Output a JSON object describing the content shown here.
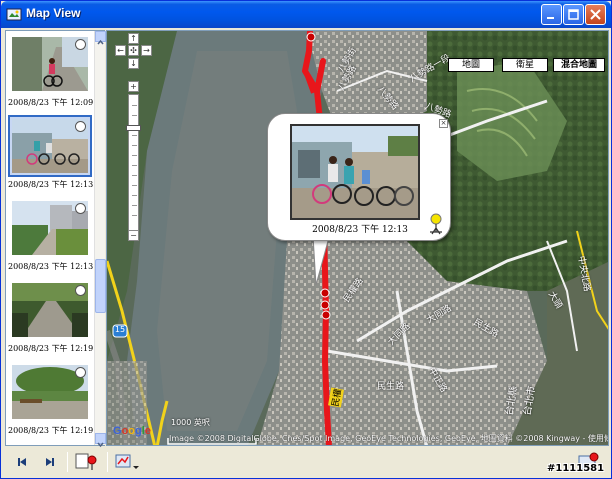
{
  "window": {
    "title": "Map View"
  },
  "thumbnails": [
    {
      "caption": "2008/8/23 下午 12:09",
      "selected": false
    },
    {
      "caption": "2008/8/23 下午 12:13",
      "selected": true
    },
    {
      "caption": "2008/8/23 下午 12:13",
      "selected": false
    },
    {
      "caption": "2008/8/23 下午 12:19",
      "selected": false
    },
    {
      "caption": "2008/8/23 下午 12:19",
      "selected": false
    }
  ],
  "map": {
    "map_types": [
      "地圖",
      "衛星",
      "混合地圖"
    ],
    "active_map_type": "混合地圖",
    "popup": {
      "caption": "2008/8/23 下午 12:13"
    },
    "scale_label": "1000 英呎",
    "copyright": "Image ©2008 DigitalGlobe, Cnes/Spot Image, GeoEye Technologies, GeoEye, 地圖資料 ©2008 Kingway - 使用條款",
    "street_labels": [
      {
        "text": "八勢街"
      },
      {
        "text": "八勢路"
      },
      {
        "text": "八勢路"
      },
      {
        "text": "八勢路一段"
      },
      {
        "text": "八勢路"
      },
      {
        "text": "民權路"
      },
      {
        "text": "大同路"
      },
      {
        "text": "大同路"
      },
      {
        "text": "民生路"
      },
      {
        "text": "民生路"
      },
      {
        "text": "中正路"
      },
      {
        "text": "台北縣"
      },
      {
        "text": "台北市"
      },
      {
        "text": "民權"
      },
      {
        "text": "大頭"
      },
      {
        "text": "中央北路"
      }
    ],
    "route_number": "15"
  },
  "watermark": "#1111581",
  "colors": {
    "title_blue": "#0058ee",
    "route_red": "#e8161b",
    "road_yellow": "#f2d21b"
  }
}
